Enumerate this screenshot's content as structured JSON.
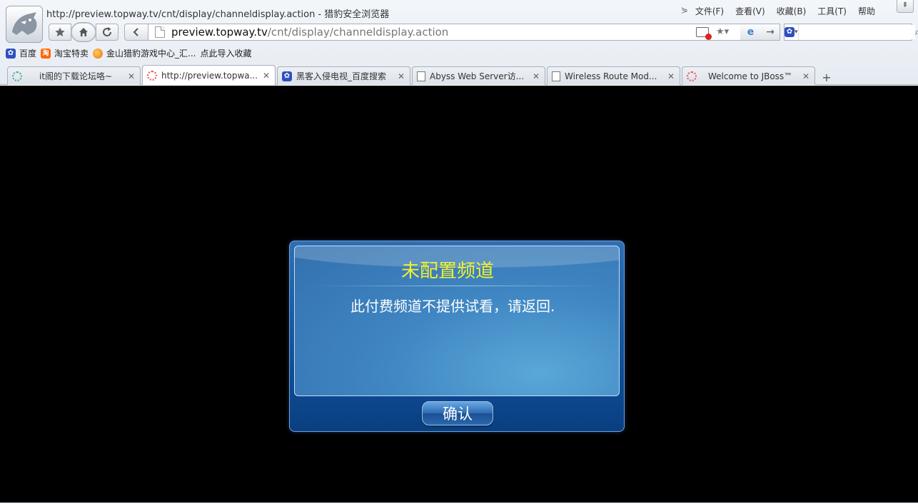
{
  "window": {
    "title": "http://preview.topway.tv/cnt/display/channeldisplay.action - 猎豹安全浏览器",
    "collapse_glyph": "⋟",
    "up_glyph": "⇞"
  },
  "menu": [
    "文件(F)",
    "查看(V)",
    "收藏(B)",
    "工具(T)",
    "帮助"
  ],
  "address": {
    "host": "preview.topway.tv",
    "path": "/cnt/display/channeldisplay.action"
  },
  "search": {
    "value": "",
    "placeholder": ""
  },
  "bookmarks": [
    {
      "label": "百度",
      "icon": "baidu-paw-icon"
    },
    {
      "label": "淘宝特卖",
      "icon": "taobao-icon"
    },
    {
      "label": "金山猎豹游戏中心_汇...",
      "icon": "game-center-icon"
    },
    {
      "label": "点此导入收藏",
      "icon": ""
    }
  ],
  "tabs": [
    {
      "label": "it阁的下载论坛咯~",
      "icon": "loading-icon",
      "active": false
    },
    {
      "label": "http://preview.topwa...",
      "icon": "loading-icon",
      "active": true
    },
    {
      "label": "黑客入侵电视_百度搜索",
      "icon": "baidu-paw-icon",
      "active": false
    },
    {
      "label": "Abyss Web Server访...",
      "icon": "page-icon",
      "active": false
    },
    {
      "label": "Wireless Route Mod...",
      "icon": "page-icon",
      "active": false
    },
    {
      "label": "Welcome to JBoss™",
      "icon": "loading-icon",
      "active": false
    }
  ],
  "new_tab_glyph": "+",
  "dialog": {
    "title": "未配置频道",
    "message": "此付费频道不提供试看，请返回.",
    "confirm_label": "确认"
  },
  "colors": {
    "dialog_title": "#f4f12c",
    "content_bg": "#000000",
    "dialog_blue": "#0d4a92"
  }
}
